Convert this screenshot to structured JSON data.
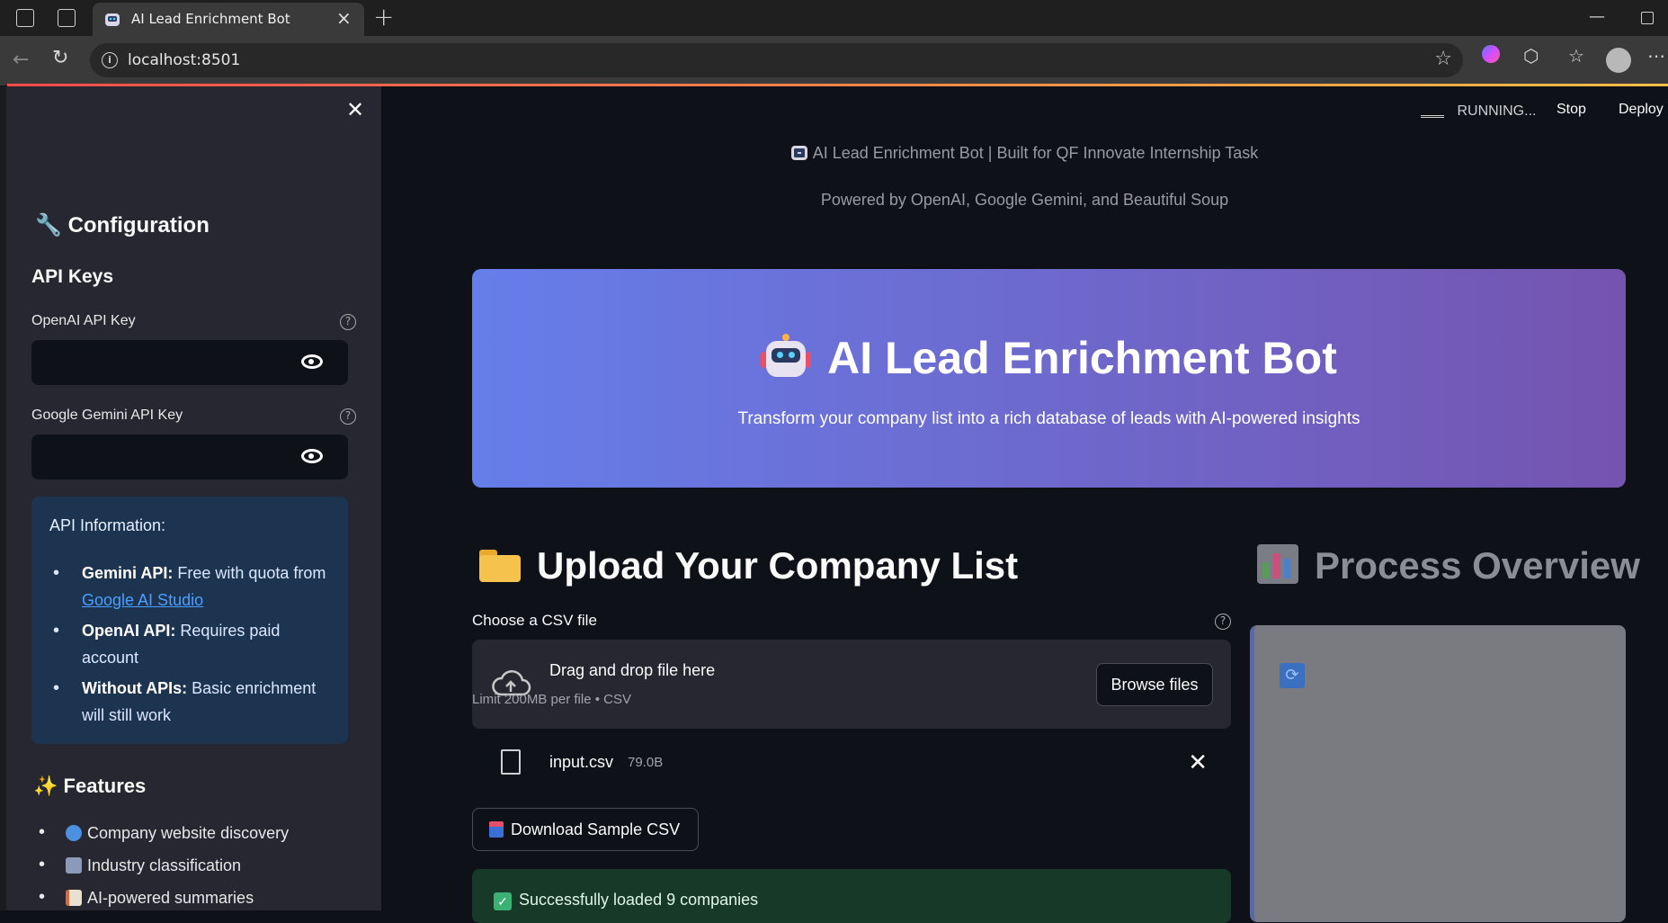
{
  "browser": {
    "tab_title": "AI Lead Enrichment Bot",
    "url": "localhost:8501"
  },
  "toolbar": {
    "status": "RUNNING...",
    "stop": "Stop",
    "deploy": "Deploy"
  },
  "sidebar": {
    "config_heading": "Configuration",
    "api_keys_heading": "API Keys",
    "openai_label": "OpenAI API Key",
    "gemini_label": "Google Gemini API Key",
    "info": {
      "title": "API Information:",
      "items": [
        {
          "bold": "Gemini API:",
          "text": " Free with quota from ",
          "link": "Google AI Studio"
        },
        {
          "bold": "OpenAI API:",
          "text": " Requires paid account"
        },
        {
          "bold": "Without APIs:",
          "text": " Basic enrichment will still work"
        }
      ]
    },
    "features_heading": "Features",
    "features": [
      "Company website discovery",
      "Industry classification",
      "AI-powered summaries"
    ]
  },
  "main": {
    "caption1": "AI Lead Enrichment Bot | Built for QF Innovate Internship Task",
    "caption2": "Powered by OpenAI, Google Gemini, and Beautiful Soup",
    "hero_title": "AI Lead Enrichment Bot",
    "hero_subtitle": "Transform your company list into a rich database of leads with AI-powered insights",
    "upload_heading": "Upload Your Company List",
    "process_heading": "Process Overview",
    "csv_label": "Choose a CSV file",
    "drop_text": "Drag and drop file here",
    "limit_text": "Limit 200MB per file • CSV",
    "browse_label": "Browse files",
    "file_name": "input.csv",
    "file_size": "79.0B",
    "download_label": "Download Sample CSV",
    "success_text": "Successfully loaded 9 companies"
  },
  "colors": {
    "hero_start": "#667eea",
    "hero_end": "#7554b0",
    "success_bg": "#173928",
    "info_bg": "#1d3450"
  }
}
